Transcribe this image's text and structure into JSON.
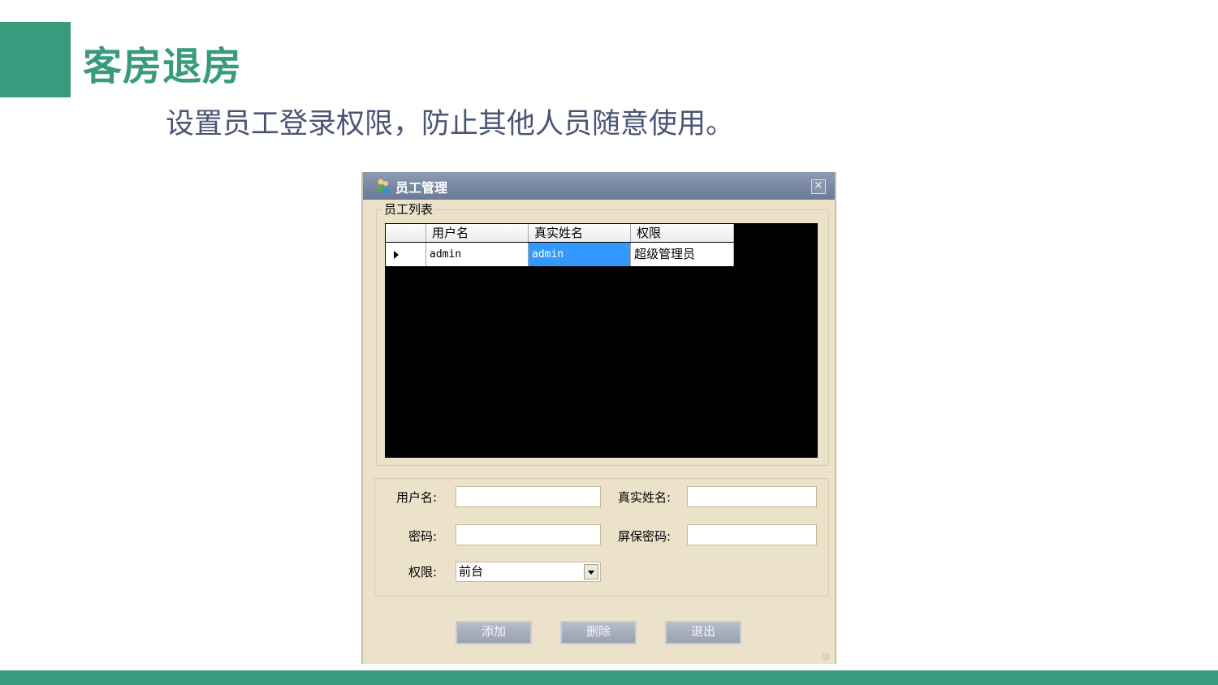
{
  "slide": {
    "title": "客房退房",
    "subtitle": "设置员工登录权限，防止其他人员随意使用。",
    "accent_color": "#3a9a7e"
  },
  "window": {
    "title": "员工管理",
    "icon": "people-icon",
    "close_label": "✕"
  },
  "staff_list": {
    "group_label": "员工列表",
    "columns": [
      "用户名",
      "真实姓名",
      "权限"
    ],
    "rows": [
      {
        "username": "admin",
        "real_name": "admin",
        "permission": "超级管理员"
      }
    ]
  },
  "form": {
    "username_label": "用户名:",
    "username_value": "",
    "real_name_label": "真实姓名:",
    "real_name_value": "",
    "password_label": "密码:",
    "password_value": "",
    "screen_password_label": "屏保密码:",
    "screen_password_value": "",
    "permission_label": "权限:",
    "permission_selected": "前台"
  },
  "buttons": {
    "add": "添加",
    "delete": "删除",
    "exit": "退出"
  }
}
